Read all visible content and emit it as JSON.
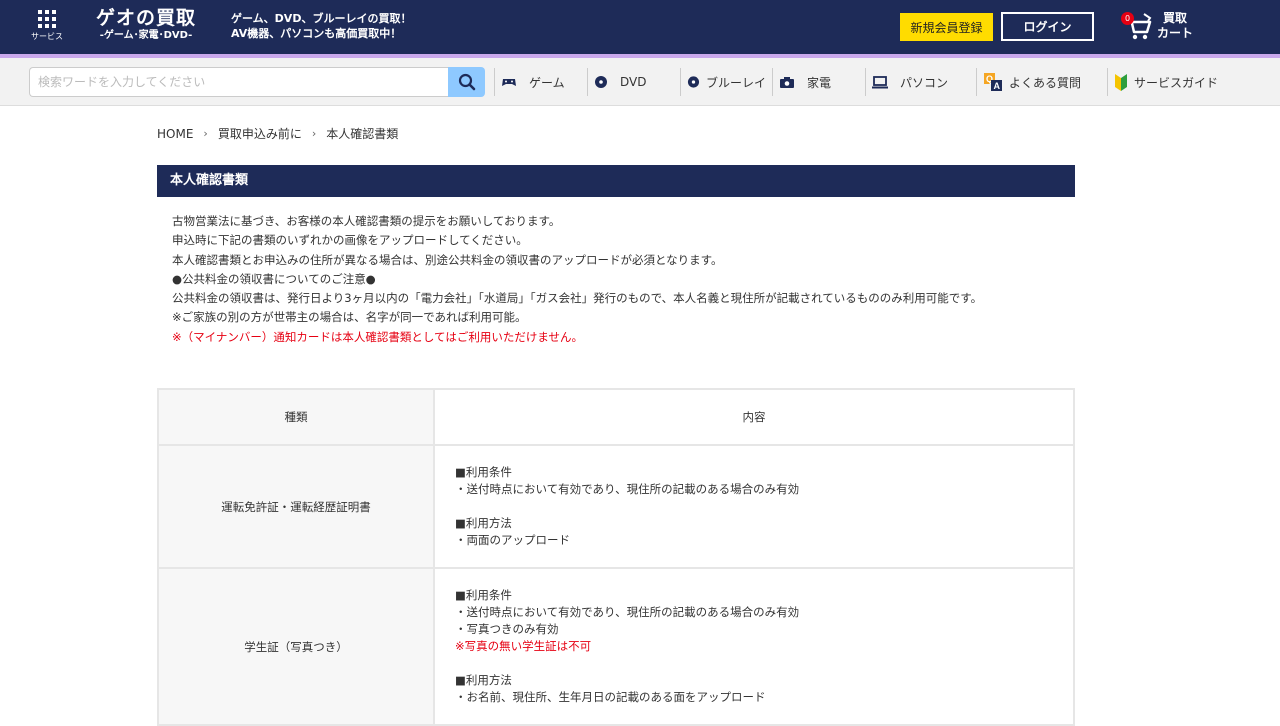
{
  "header": {
    "services_label": "サービス",
    "logo_main": "ゲオの買取",
    "logo_sub": "-ゲーム･家電･DVD-",
    "tagline_1": "ゲーム、DVD、ブルーレイの買取！",
    "tagline_2": "AV機器、パソコンも高価買取中！",
    "register_label": "新規会員登録",
    "login_label": "ログイン",
    "cart_count": "0",
    "cart_label_1": "買取",
    "cart_label_2": "カート"
  },
  "nav": {
    "search_placeholder": "検索ワードを入力してください",
    "items": [
      {
        "label": "ゲーム",
        "icon": "gamepad-icon"
      },
      {
        "label": "DVD",
        "icon": "dvd-icon"
      },
      {
        "label": "ブルーレイ",
        "icon": "bluray-icon"
      },
      {
        "label": "家電",
        "icon": "camera-icon"
      },
      {
        "label": "パソコン",
        "icon": "pc-icon"
      },
      {
        "label": "よくある質問",
        "icon": "qa-icon"
      },
      {
        "label": "サービスガイド",
        "icon": "beginner-mark-icon"
      }
    ]
  },
  "breadcrumb": {
    "home": "HOME",
    "parent": "買取申込み前に",
    "current": "本人確認書類"
  },
  "section": {
    "title": "本人確認書類",
    "intro": [
      "古物営業法に基づき、お客様の本人確認書類の提示をお願いしております。",
      "申込時に下記の書類のいずれかの画像をアップロードしてください。",
      "本人確認書類とお申込みの住所が異なる場合は、別途公共料金の領収書のアップロードが必須となります。",
      "●公共料金の領収書についてのご注意●",
      "公共料金の領収書は、発行日より3ヶ月以内の「電力会社」「水道局」「ガス会社」発行のもので、本人名義と現住所が記載されているもののみ利用可能です。",
      "※ご家族の別の方が世帯主の場合は、名字が同一であれば利用可能。"
    ],
    "intro_warning": "※（マイナンバー）通知カードは本人確認書類としてはご利用いただけません。"
  },
  "table": {
    "header_type": "種類",
    "header_content": "内容",
    "rows": [
      {
        "type": "運転免許証・運転経歴証明書",
        "cond_heading": "■利用条件",
        "cond_1": "・送付時点において有効であり、現住所の記載のある場合のみ有効",
        "method_heading": "■利用方法",
        "method_1": "・両面のアップロード"
      },
      {
        "type": "学生証（写真つき）",
        "cond_heading": "■利用条件",
        "cond_1": "・送付時点において有効であり、現住所の記載のある場合のみ有効",
        "cond_2": "・写真つきのみ有効",
        "cond_warning": "※写真の無い学生証は不可",
        "method_heading": "■利用方法",
        "method_1": "・お名前、現住所、生年月日の記載のある面をアップロード"
      }
    ]
  },
  "colors": {
    "header_bg": "#1e2b58",
    "accent_yellow": "#ffdc00",
    "warning_red": "#e60012",
    "search_button": "#8ec9ff"
  }
}
